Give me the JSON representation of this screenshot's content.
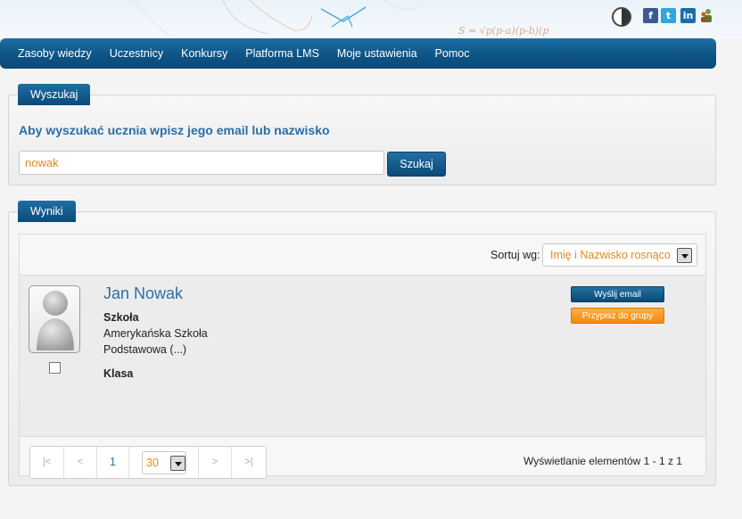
{
  "nav": {
    "items": [
      {
        "label": "Zasoby wiedzy"
      },
      {
        "label": "Uczestnicy"
      },
      {
        "label": "Konkursy"
      },
      {
        "label": "Platforma LMS"
      },
      {
        "label": "Moje ustawienia"
      },
      {
        "label": "Pomoc"
      }
    ]
  },
  "header": {
    "icons": [
      "contrast-icon",
      "facebook-icon",
      "twitter-icon",
      "linkedin-icon",
      "users-icon"
    ]
  },
  "search": {
    "tab": "Wyszukaj",
    "heading": "Aby wyszukać ucznia wpisz jego email lub nazwisko",
    "value": "nowak",
    "button": "Szukaj"
  },
  "results": {
    "tab": "Wyniki",
    "sort_label": "Sortuj wg:",
    "sort_value": "Imię i Nazwisko rosnąco",
    "items": [
      {
        "name": "Jan Nowak",
        "school_label": "Szkoła",
        "school_line1": "Amerykańska Szkoła",
        "school_line2": "Podstawowa (...)",
        "class_label": "Klasa",
        "email_button": "Wyślij email",
        "group_button": "Przypisz do grupy"
      }
    ],
    "pager": {
      "first": "|<",
      "prev": "<",
      "page": "1",
      "page_size": "30",
      "next": ">",
      "last": ">|",
      "info": "Wyświetlanie elementów 1 - 1 z 1"
    }
  },
  "colors": {
    "primary": "#0d5487",
    "accent": "#f08a0c",
    "link": "#2a6ea6",
    "input_text": "#e08a1e"
  }
}
